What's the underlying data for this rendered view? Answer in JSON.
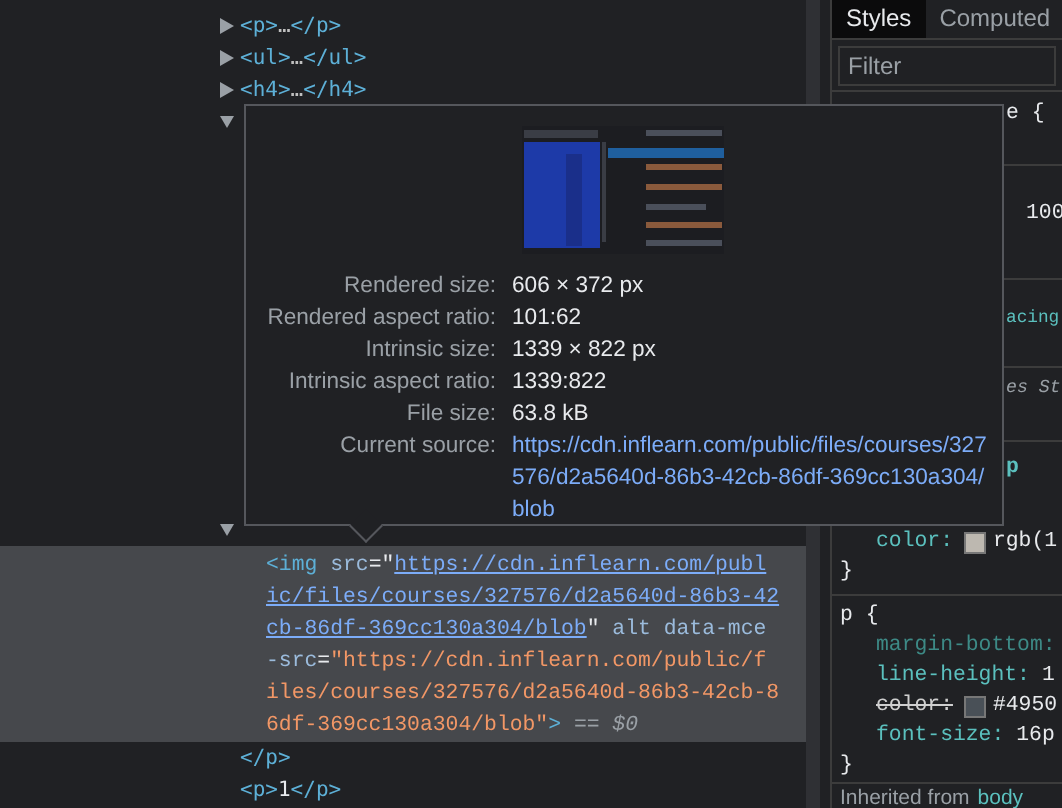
{
  "elements_panel": {
    "rows_above": [
      {
        "expanded": false,
        "parts": [
          {
            "kind": "tag",
            "text": "<p>"
          },
          {
            "kind": "ellipsis",
            "text": "…"
          },
          {
            "kind": "tag",
            "text": "</p>"
          }
        ]
      },
      {
        "expanded": false,
        "parts": [
          {
            "kind": "tag",
            "text": "<ul>"
          },
          {
            "kind": "ellipsis",
            "text": "…"
          },
          {
            "kind": "tag",
            "text": "</ul>"
          }
        ]
      },
      {
        "expanded": false,
        "parts": [
          {
            "kind": "tag",
            "text": "<h4>"
          },
          {
            "kind": "ellipsis",
            "text": "…"
          },
          {
            "kind": "tag",
            "text": "</h4>"
          }
        ]
      }
    ],
    "hidden_row": {
      "expanded": true
    },
    "parent_row": {
      "expanded": true
    },
    "selected_node": {
      "selected": true,
      "parts": [
        {
          "kind": "tag",
          "text": "<img"
        },
        {
          "kind": "attr",
          "text": " src"
        },
        {
          "kind": "punct",
          "text": "=\""
        },
        {
          "kind": "link",
          "text": "https://cdn.inflearn.com/public/files/courses/327576/d2a5640d-86b3-42cb-86df-369cc130a304/blob"
        },
        {
          "kind": "punct",
          "text": "\""
        },
        {
          "kind": "attr",
          "text": " alt data-mce-src"
        },
        {
          "kind": "punct",
          "text": "="
        },
        {
          "kind": "value",
          "text": "\"https://cdn.inflearn.com/public/files/courses/327576/d2a5640d-86b3-42cb-86df-369cc130a304/blob\""
        },
        {
          "kind": "tag",
          "text": ">"
        },
        {
          "kind": "marker",
          "text": " == $0"
        }
      ]
    },
    "rows_below": [
      {
        "parts": [
          {
            "kind": "tag",
            "text": "</p>"
          }
        ]
      },
      {
        "parts": [
          {
            "kind": "tag",
            "text": "<p>"
          },
          {
            "kind": "text",
            "text": "1"
          },
          {
            "kind": "tag",
            "text": "</p>"
          }
        ]
      }
    ]
  },
  "image_tooltip": {
    "fields": [
      {
        "label": "Rendered size:",
        "value": "606 × 372 px"
      },
      {
        "label": "Rendered aspect ratio:",
        "value": "101:62"
      },
      {
        "label": "Intrinsic size:",
        "value": "1339 × 822 px"
      },
      {
        "label": "Intrinsic aspect ratio:",
        "value": "1339:822"
      },
      {
        "label": "File size:",
        "value": "63.8 kB"
      }
    ],
    "source": {
      "label": "Current source:",
      "url": "https://cdn.inflearn.com/public/files/courses/327576/d2a5640d-86b3-42cb-86df-369cc130a304/blob"
    }
  },
  "styles_panel": {
    "tabs": [
      {
        "label": "Styles",
        "selected": true
      },
      {
        "label": "Computed",
        "selected": false
      }
    ],
    "filter": {
      "placeholder": "Filter"
    },
    "blocks": [
      {
        "lines": [
          {
            "kind": "fragment",
            "text": "e {"
          }
        ]
      },
      {
        "lines": [
          {
            "kind": "fragment",
            "text": "100"
          }
        ]
      },
      {
        "lines": [
          {
            "kind": "property-fragment",
            "text": "acing"
          }
        ]
      },
      {
        "lines": [
          {
            "kind": "header",
            "text": "es St"
          }
        ]
      },
      {
        "lines": [
          {
            "kind": "selector-fragment",
            "text": "p"
          },
          {
            "kind": "decl",
            "property": "color:",
            "value": "rgb(1",
            "color": "#bdb8b0",
            "overridden": false,
            "inactive": false
          },
          {
            "kind": "close",
            "text": "}"
          }
        ]
      },
      {
        "lines": [
          {
            "kind": "selector",
            "text": "p {"
          },
          {
            "kind": "decl",
            "property": "margin-bottom:",
            "overridden": false,
            "inactive": true
          },
          {
            "kind": "decl",
            "property": "line-height:",
            "value": "1",
            "overridden": false,
            "inactive": false
          },
          {
            "kind": "decl",
            "property": "color:",
            "value": "#4950",
            "color": "#495057",
            "overridden": true,
            "inactive": false
          },
          {
            "kind": "decl",
            "property": "font-size:",
            "value": "16p",
            "overridden": false,
            "inactive": false
          },
          {
            "kind": "close",
            "text": "}"
          }
        ]
      },
      {
        "lines": [
          {
            "kind": "inherited",
            "text": "Inherited from",
            "link": "body"
          }
        ]
      }
    ]
  }
}
